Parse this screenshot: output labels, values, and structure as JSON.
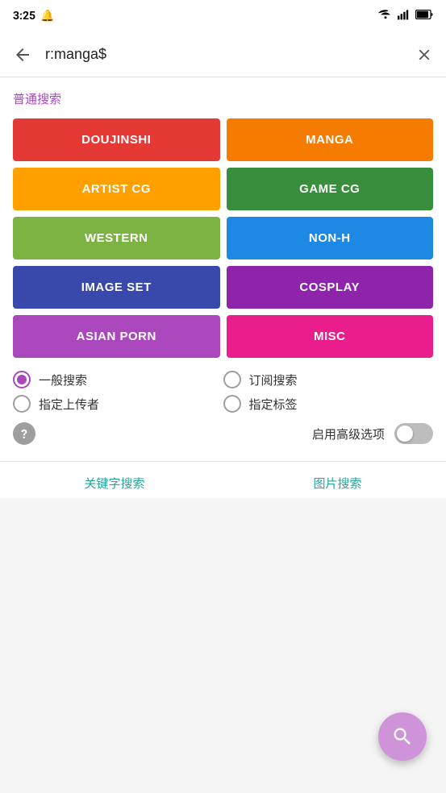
{
  "statusBar": {
    "time": "3:25",
    "wifiIcon": "wifi-icon",
    "signalIcon": "signal-icon",
    "batteryIcon": "battery-icon"
  },
  "searchBar": {
    "query": "r:manga$",
    "backIcon": "back-icon",
    "clearIcon": "clear-icon"
  },
  "searchPanel": {
    "sectionTitle": "普通搜索",
    "categories": [
      {
        "id": "doujinshi",
        "label": "DOUJINSHI",
        "colorClass": "cat-doujinshi"
      },
      {
        "id": "manga",
        "label": "MANGA",
        "colorClass": "cat-manga"
      },
      {
        "id": "artist-cg",
        "label": "ARTIST CG",
        "colorClass": "cat-artist-cg"
      },
      {
        "id": "game-cg",
        "label": "GAME CG",
        "colorClass": "cat-game-cg"
      },
      {
        "id": "western",
        "label": "WESTERN",
        "colorClass": "cat-western"
      },
      {
        "id": "non-h",
        "label": "NON-H",
        "colorClass": "cat-non-h"
      },
      {
        "id": "image-set",
        "label": "IMAGE SET",
        "colorClass": "cat-image-set"
      },
      {
        "id": "cosplay",
        "label": "COSPLAY",
        "colorClass": "cat-cosplay"
      },
      {
        "id": "asian-porn",
        "label": "ASIAN PORN",
        "colorClass": "cat-asian-porn"
      },
      {
        "id": "misc",
        "label": "MISC",
        "colorClass": "cat-misc"
      }
    ],
    "radioOptions": [
      {
        "id": "general-search",
        "label": "一般搜索",
        "selected": true,
        "col": 0
      },
      {
        "id": "subscription-search",
        "label": "订阅搜索",
        "selected": false,
        "col": 1
      },
      {
        "id": "uploader-search",
        "label": "指定上传者",
        "selected": false,
        "col": 0
      },
      {
        "id": "tag-search",
        "label": "指定标签",
        "selected": false,
        "col": 1
      }
    ],
    "advancedLabel": "启用高级选项",
    "helpIcon": "help-icon",
    "toggleEnabled": false
  },
  "footer": {
    "keywordSearchLabel": "关键字搜索",
    "imageSearchLabel": "图片搜索"
  },
  "fab": {
    "searchIcon": "search-fab-icon"
  }
}
